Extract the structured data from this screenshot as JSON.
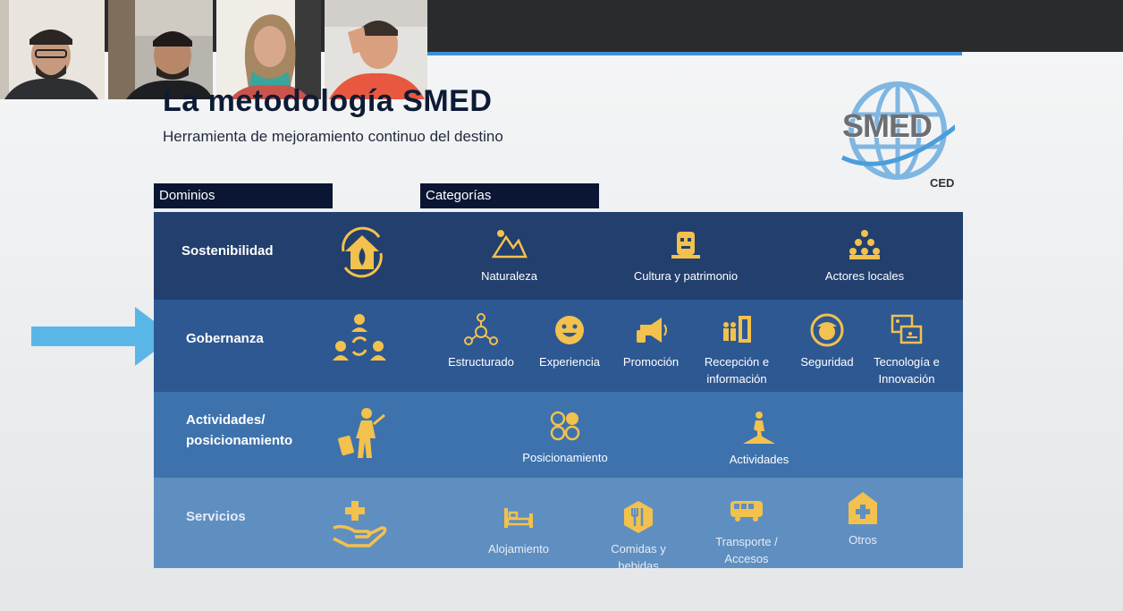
{
  "slide": {
    "title": "La metodología SMED",
    "subtitle": "Herramienta de mejoramiento continuo del destino",
    "logo_text": "SMED",
    "logo_sub": "CED"
  },
  "headers": {
    "domains": "Dominios",
    "categories": "Categorías"
  },
  "rows": [
    {
      "domain": "Sostenibilidad",
      "domain_icon": "eco-house-icon",
      "categories": [
        {
          "label": "Naturaleza",
          "icon": "mountains-icon"
        },
        {
          "label": "Cultura y patrimonio",
          "icon": "culture-mask-icon"
        },
        {
          "label": "Actores locales",
          "icon": "people-group-icon"
        }
      ]
    },
    {
      "domain": "Gobernanza",
      "domain_icon": "governance-people-icon",
      "categories": [
        {
          "label": "Estructurado",
          "icon": "network-icon"
        },
        {
          "label": "Experiencia",
          "icon": "smiley-icon"
        },
        {
          "label": "Promoción",
          "icon": "megaphone-icon"
        },
        {
          "label": "Recepción e",
          "label2": "información",
          "icon": "reception-door-icon"
        },
        {
          "label": "Seguridad",
          "icon": "security-guard-icon"
        },
        {
          "label": "Tecnología e",
          "label2": "Innovación",
          "icon": "technology-icon"
        }
      ]
    },
    {
      "domain": "Actividades/",
      "domain2": "posicionamiento",
      "domain_icon": "traveler-icon",
      "categories": [
        {
          "label": "Posicionamiento",
          "icon": "circles-icon"
        },
        {
          "label": "Actividades",
          "icon": "hiker-icon"
        }
      ]
    },
    {
      "domain": "Servicios",
      "domain_icon": "care-hand-icon",
      "categories": [
        {
          "label": "Alojamiento",
          "icon": "bed-icon"
        },
        {
          "label": "Comidas y",
          "label2": "bebidas",
          "icon": "food-icon"
        },
        {
          "label": "Transporte /",
          "label2": "Accesos",
          "icon": "bus-icon"
        },
        {
          "label": "Otros",
          "icon": "health-house-icon"
        }
      ]
    }
  ],
  "colors": {
    "accent": "#3b8fd6",
    "icon_gold": "#f2c14e",
    "row_dark": "#223f6e",
    "row_mid": "#2e5892",
    "row_blue": "#3d72ad",
    "row_light": "#5f8fc0",
    "arrow": "#5bb6e8"
  }
}
